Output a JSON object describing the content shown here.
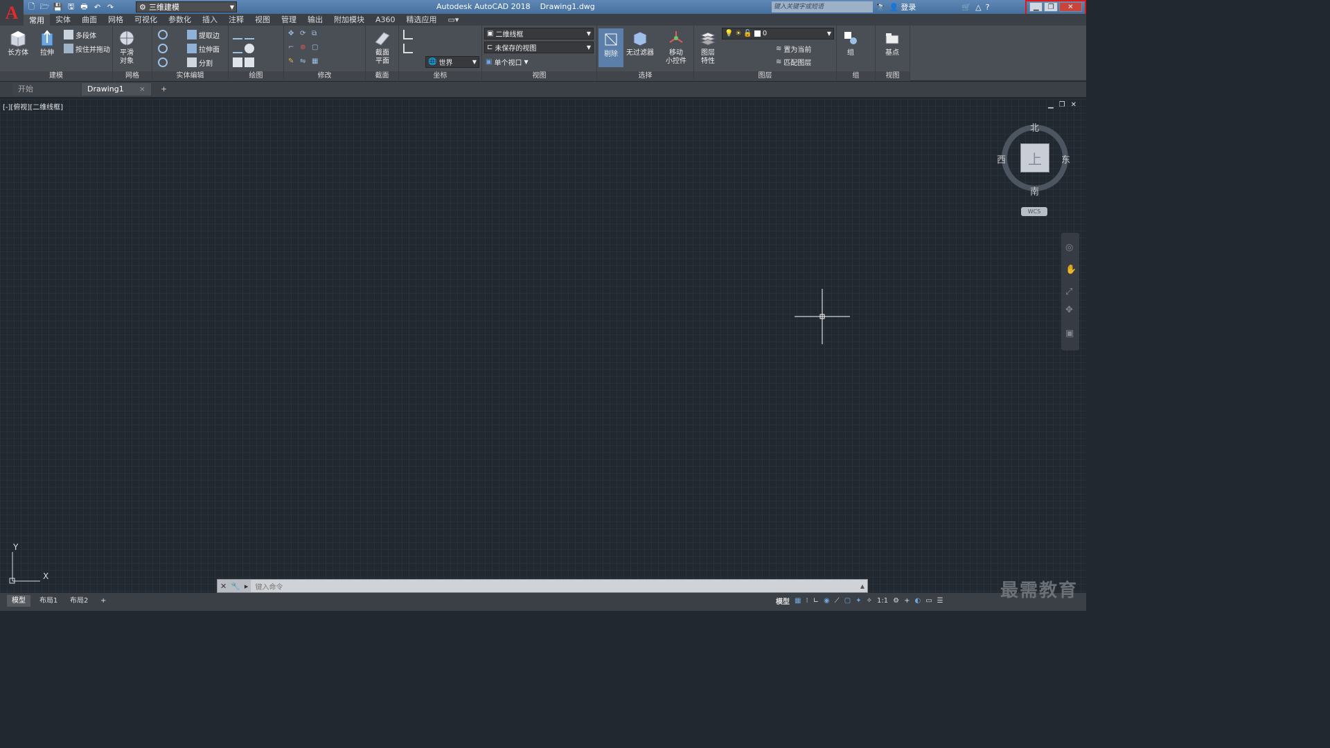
{
  "titlebar": {
    "app_letter": "A",
    "workspace": "三维建模",
    "title": "Autodesk AutoCAD 2018    Drawing1.dwg",
    "search_placeholder": "键入关键字或短语",
    "login": "登录"
  },
  "tabs": [
    "常用",
    "实体",
    "曲面",
    "网格",
    "可视化",
    "参数化",
    "插入",
    "注释",
    "视图",
    "管理",
    "输出",
    "附加模块",
    "A360",
    "精选应用"
  ],
  "ribbon": {
    "modeling": {
      "title": "建模",
      "box": "长方体",
      "extrude": "拉伸",
      "polysolid": "多段体",
      "presspull": "按住并拖动"
    },
    "mesh": {
      "title": "网格",
      "smooth": "平滑\n对象"
    },
    "solid_edit": {
      "title": "实体编辑",
      "extract_edges": "提取边",
      "extrude_faces": "拉伸面",
      "separate": "分割"
    },
    "draw": {
      "title": "绘图"
    },
    "modify": {
      "title": "修改"
    },
    "section": {
      "title": "截面",
      "plane": "截面\n平面"
    },
    "coords": {
      "title": "坐标",
      "world": "世界"
    },
    "view": {
      "title": "视图",
      "visual_style": "二维线框",
      "saved_view": "未保存的视图",
      "viewport": "单个视口"
    },
    "selection": {
      "title": "选择",
      "cull": "剔除",
      "no_filter": "无过滤器",
      "gizmo": "移动\n小控件"
    },
    "layers": {
      "title": "图层",
      "props": "图层\n特性",
      "layer_name": "0",
      "set_current": "置为当前",
      "match": "匹配图层"
    },
    "groups": {
      "title": "组",
      "group": "组"
    },
    "view2": {
      "title": "视图",
      "base": "基点"
    }
  },
  "filetabs": {
    "start": "开始",
    "drawing": "Drawing1"
  },
  "viewport": {
    "label": "[-][俯视][二维线框]",
    "north": "北",
    "south": "南",
    "east": "东",
    "west": "西",
    "top": "上",
    "wcs": "WCS",
    "ucs_x": "X",
    "ucs_y": "Y"
  },
  "command": {
    "placeholder": "键入命令"
  },
  "layouts": [
    "模型",
    "布局1",
    "布局2"
  ],
  "status": {
    "model": "模型",
    "scale": "1:1"
  },
  "watermark": "最需教育",
  "colors": {
    "background": "#212830",
    "ribbon": "#4a4e55",
    "highlight": "#e01818"
  }
}
